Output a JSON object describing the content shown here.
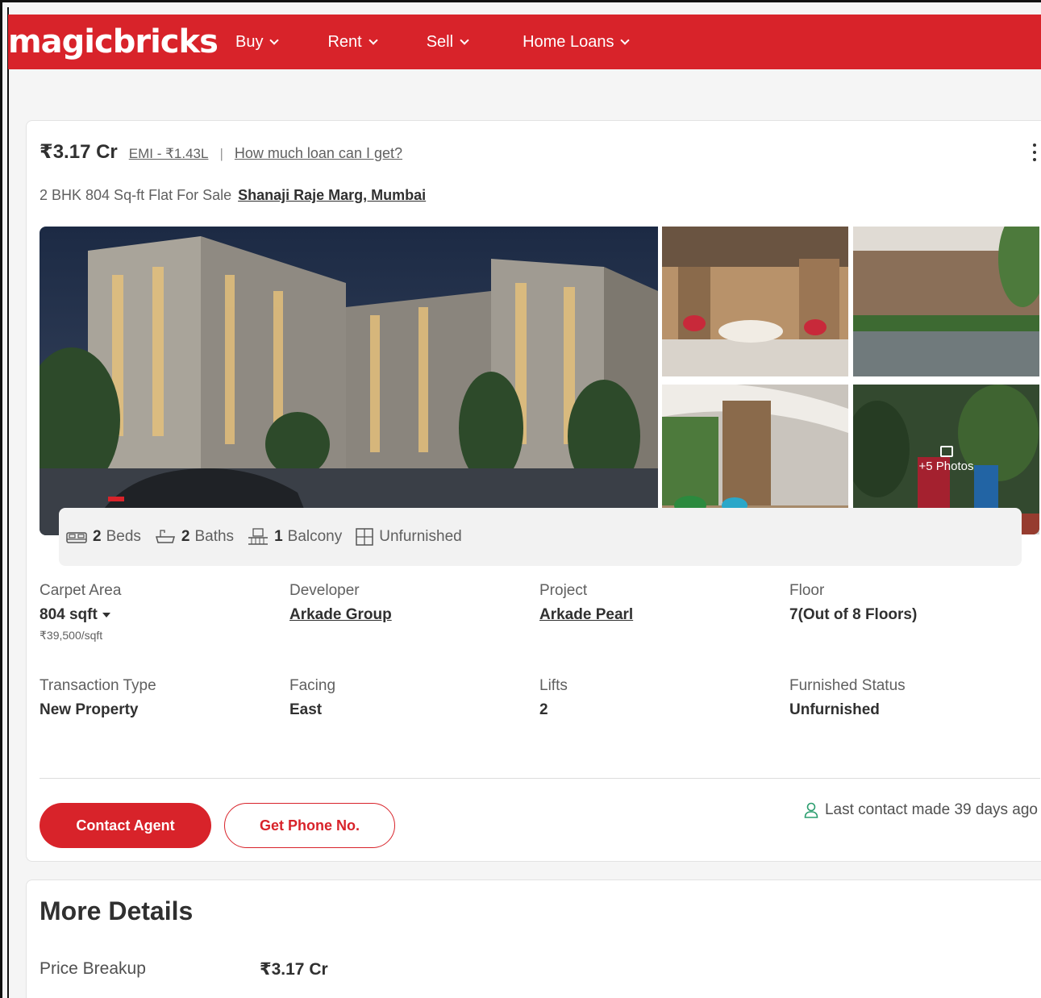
{
  "header": {
    "logo": "magicbricks",
    "nav": [
      {
        "label": "Buy"
      },
      {
        "label": "Rent"
      },
      {
        "label": "Sell"
      },
      {
        "label": "Home Loans"
      }
    ]
  },
  "listing": {
    "price": "₹3.17 Cr",
    "emi": "EMI - ₹1.43L",
    "separator": "|",
    "loan_link": "How much loan can I get?",
    "subtitle": "2 BHK 804 Sq-ft Flat For Sale",
    "location": "Shanaji Raje Marg, Mumbai",
    "more_photos": "+5 Photos",
    "summary": {
      "beds_count": "2",
      "beds_label": "Beds",
      "baths_count": "2",
      "baths_label": "Baths",
      "balcony_count": "1",
      "balcony_label": "Balcony",
      "furnishing": "Unfurnished"
    },
    "details": {
      "carpet_area_label": "Carpet Area",
      "carpet_area_value": "804 sqft",
      "carpet_area_rate": "₹39,500/sqft",
      "developer_label": "Developer",
      "developer_value": "Arkade Group",
      "project_label": "Project",
      "project_value": "Arkade Pearl",
      "floor_label": "Floor",
      "floor_value": "7(Out of 8 Floors)",
      "transaction_label": "Transaction Type",
      "transaction_value": "New Property",
      "facing_label": "Facing",
      "facing_value": "East",
      "lifts_label": "Lifts",
      "lifts_value": "2",
      "furnished_label": "Furnished Status",
      "furnished_value": "Unfurnished"
    },
    "actions": {
      "contact_agent": "Contact Agent",
      "get_phone": "Get Phone No.",
      "last_contact": "Last contact made 39 days ago"
    }
  },
  "more_details": {
    "title": "More Details",
    "price_breakup_label": "Price Breakup",
    "price_breakup_value": "₹3.17 Cr"
  },
  "colors": {
    "brand_red": "#d8232a",
    "text_dark": "#303030",
    "text_muted": "#606060",
    "contact_icon_green": "#2a9d6e"
  }
}
